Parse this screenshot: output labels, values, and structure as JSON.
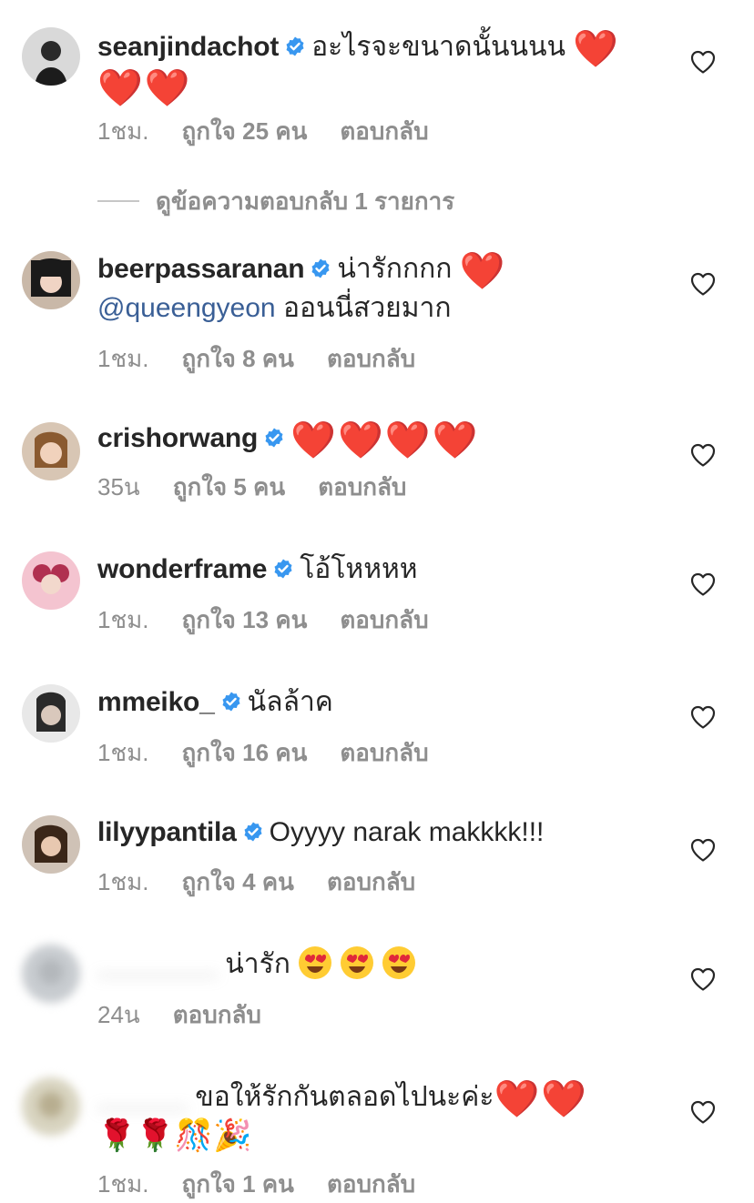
{
  "comments": [
    {
      "username": "seanjindachot",
      "text": "อะไรจะขนาดนั้นนนน",
      "hearts": "❤️",
      "hearts2": "❤️❤️",
      "time": "1ชม.",
      "likes": "ถูกใจ 25 คน",
      "reply": "ตอบกลับ"
    },
    {
      "username": "beerpassaranan",
      "text": "น่ารักกกก",
      "mention": "@queengyeon",
      "text2": "ออนนี่สวยมาก",
      "hearts": "❤️",
      "time": "1ชม.",
      "likes": "ถูกใจ 8 คน",
      "reply": "ตอบกลับ"
    },
    {
      "username": "crishorwang",
      "hearts": "❤️❤️❤️❤️",
      "time": "35น",
      "likes": "ถูกใจ 5 คน",
      "reply": "ตอบกลับ"
    },
    {
      "username": "wonderframe",
      "text": "โอ้โหหหห",
      "time": "1ชม.",
      "likes": "ถูกใจ 13 คน",
      "reply": "ตอบกลับ"
    },
    {
      "username": "mmeiko_",
      "text": "นัลล้าค",
      "time": "1ชม.",
      "likes": "ถูกใจ 16 คน",
      "reply": "ตอบกลับ"
    },
    {
      "username": "lilyypantila",
      "text": "Oyyyy narak makkkk!!!",
      "time": "1ชม.",
      "likes": "ถูกใจ 4 คน",
      "reply": "ตอบกลับ"
    },
    {
      "username": "________",
      "text": "น่ารัก",
      "time": "24น",
      "reply": "ตอบกลับ"
    },
    {
      "username": "______",
      "text": "ขอให้รักกันตลอดไปนะค่ะ",
      "hearts": "❤️❤️",
      "emojis": "🌹🌹🎊🎉",
      "time": "1ชม.",
      "likes": "ถูกใจ 1 คน",
      "reply": "ตอบกลับ"
    }
  ],
  "view_replies": "ดูข้อความตอบกลับ 1 รายการ",
  "icons": {
    "verified": "verified-badge-icon",
    "like": "heart-outline-icon",
    "smile": "smiling-face-with-heart-eyes-icon"
  },
  "colors": {
    "verified": "#3897f0",
    "muted": "#8e8e8e",
    "mention": "#3a5f96",
    "heart": "#ed1c24"
  }
}
